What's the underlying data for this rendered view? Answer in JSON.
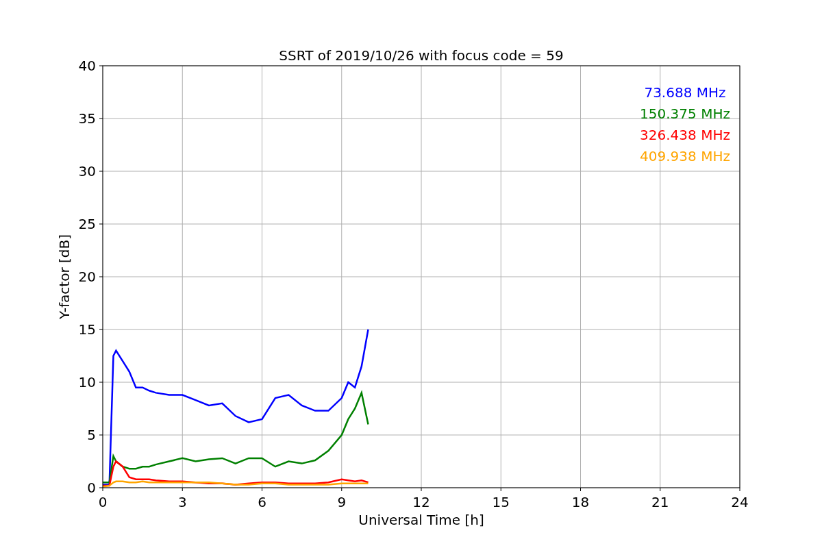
{
  "figure": {
    "chart_data": {
      "type": "line",
      "title": "SSRT of 2019/10/26 with focus code = 59",
      "xlabel": "Universal Time [h]",
      "ylabel": "Y-factor [dB]",
      "x": [
        0,
        0.25,
        0.4,
        0.5,
        0.75,
        1,
        1.25,
        1.5,
        1.75,
        2,
        2.5,
        3,
        3.5,
        4,
        4.5,
        5,
        5.5,
        6,
        6.5,
        7,
        7.5,
        8,
        8.5,
        9,
        9.25,
        9.5,
        9.75,
        10
      ],
      "series": [
        {
          "name": "73.688 MHz",
          "color": "#0000ff",
          "values": [
            0.3,
            0.3,
            12.5,
            13,
            12,
            11,
            9.5,
            9.5,
            9.2,
            9,
            8.8,
            8.8,
            8.3,
            7.8,
            8,
            6.8,
            6.2,
            6.5,
            8.5,
            8.8,
            7.8,
            7.3,
            7.3,
            8.5,
            10,
            9.5,
            11.5,
            15
          ]
        },
        {
          "name": "150.375 MHz",
          "color": "#008000",
          "values": [
            0.5,
            0.5,
            3,
            2.5,
            2,
            1.8,
            1.8,
            2,
            2,
            2.2,
            2.5,
            2.8,
            2.5,
            2.7,
            2.8,
            2.3,
            2.8,
            2.8,
            2,
            2.5,
            2.3,
            2.6,
            3.5,
            5,
            6.5,
            7.5,
            9,
            6
          ]
        },
        {
          "name": "326.438 MHz",
          "color": "#ff0000",
          "values": [
            0.2,
            0.2,
            2,
            2.5,
            2,
            1,
            0.8,
            0.8,
            0.8,
            0.7,
            0.6,
            0.6,
            0.5,
            0.4,
            0.4,
            0.3,
            0.4,
            0.5,
            0.5,
            0.4,
            0.4,
            0.4,
            0.5,
            0.8,
            0.7,
            0.6,
            0.7,
            0.5
          ]
        },
        {
          "name": "409.938 MHz",
          "color": "#ffa500",
          "values": [
            0.1,
            0.2,
            0.5,
            0.6,
            0.6,
            0.5,
            0.5,
            0.6,
            0.5,
            0.5,
            0.5,
            0.5,
            0.5,
            0.5,
            0.4,
            0.3,
            0.3,
            0.4,
            0.4,
            0.3,
            0.3,
            0.3,
            0.3,
            0.4,
            0.4,
            0.4,
            0.4,
            0.4
          ]
        }
      ],
      "grid": true,
      "xlim": [
        0,
        24
      ],
      "ylim": [
        0,
        40
      ],
      "xticks": [
        0,
        3,
        6,
        9,
        12,
        15,
        18,
        21,
        24
      ],
      "yticks": [
        0,
        5,
        10,
        15,
        20,
        25,
        30,
        35,
        40
      ]
    }
  }
}
